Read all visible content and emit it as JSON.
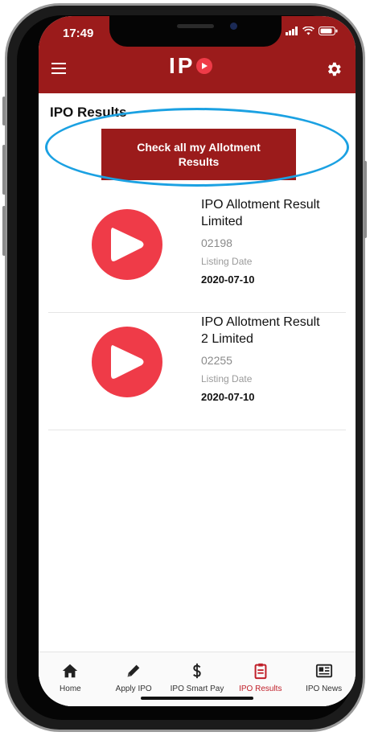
{
  "status_bar": {
    "time": "17:49"
  },
  "app_bar": {
    "logo_text": "IP",
    "menu_icon": "hamburger-menu-icon",
    "settings_icon": "gear-icon"
  },
  "page": {
    "title": "IPO Results",
    "cta_label_line1": "Check all my Allotment",
    "cta_label_line2": "Results"
  },
  "results": [
    {
      "name_line1": "IPO Allotment Result",
      "name_line2": "Limited",
      "code": "02198",
      "date_label": "Listing Date",
      "date": "2020-07-10"
    },
    {
      "name_line1": "IPO Allotment Result",
      "name_line2": "2 Limited",
      "code": "02255",
      "date_label": "Listing Date",
      "date": "2020-07-10"
    }
  ],
  "bottom_nav": [
    {
      "label": "Home",
      "icon": "home-icon"
    },
    {
      "label": "Apply IPO",
      "icon": "pencil-icon"
    },
    {
      "label": "IPO Smart Pay",
      "icon": "dollar-icon"
    },
    {
      "label": "IPO Results",
      "icon": "clipboard-icon",
      "active": true
    },
    {
      "label": "IPO News",
      "icon": "newspaper-icon"
    }
  ],
  "colors": {
    "brand": "#9b1b1b",
    "accent": "#ef3b48",
    "highlight": "#1ba1e2",
    "active_nav": "#c0202a"
  }
}
